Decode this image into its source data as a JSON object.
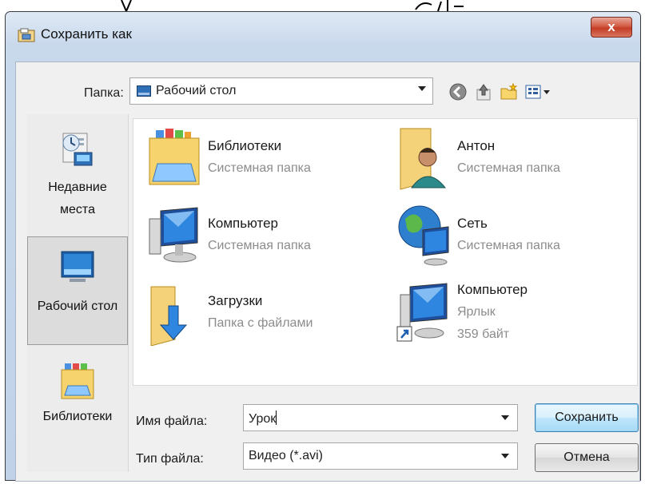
{
  "window": {
    "title": "Сохранить как",
    "close_label": "x"
  },
  "toolbar": {
    "folder_label": "Папка:",
    "folder_value": "Рабочий стол",
    "buttons": [
      "back-icon",
      "up-folder-icon",
      "new-folder-icon",
      "view-menu-icon"
    ]
  },
  "places": [
    {
      "label": "Недавние места",
      "icon": "recent-places-icon"
    },
    {
      "label": "Рабочий стол",
      "icon": "desktop-icon",
      "selected": true
    },
    {
      "label": "Библиотеки",
      "icon": "libraries-icon"
    }
  ],
  "files": [
    {
      "name": "Библиотеки",
      "sub1": "Системная папка",
      "icon": "libraries-folder-icon"
    },
    {
      "name": "Антон",
      "sub1": "Системная папка",
      "icon": "user-folder-icon"
    },
    {
      "name": "Компьютер",
      "sub1": "Системная папка",
      "icon": "computer-icon"
    },
    {
      "name": "Сеть",
      "sub1": "Системная папка",
      "icon": "network-icon"
    },
    {
      "name": "Загрузки",
      "sub1": "Папка с файлами",
      "icon": "downloads-folder-icon"
    },
    {
      "name": "Компьютер",
      "sub1": "Ярлык",
      "sub2": "359 байт",
      "icon": "computer-shortcut-icon"
    }
  ],
  "form": {
    "filename_label": "Имя файла:",
    "filename_value": "Урок",
    "filetype_label": "Тип файла:",
    "filetype_value": "Видео (*.avi)",
    "save_label": "Сохранить",
    "cancel_label": "Отмена"
  },
  "colors": {
    "title_gradient_top": "#dfe9f5",
    "close_red": "#c43c26",
    "default_button_blue": "#3c7fb1",
    "secondary_text": "#8c8c8c"
  }
}
